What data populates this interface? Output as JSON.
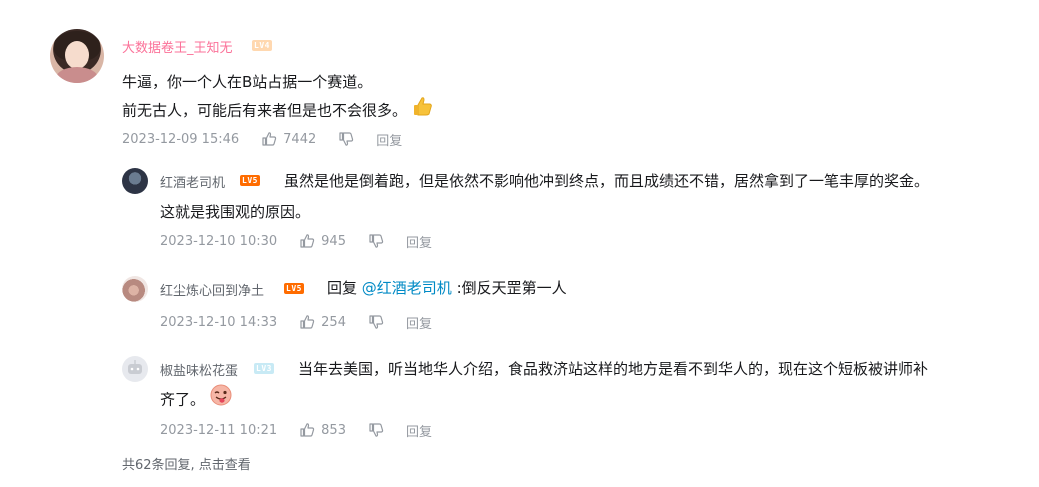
{
  "main_comment": {
    "username": "大数据卷王_王知无",
    "level": "LV4",
    "line1": "牛逼，你一个人在B站占据一个赛道。",
    "line2": "前无古人，可能后有来者但是也不会很多。",
    "line2_emoji": "thumbs-up",
    "time": "2023-12-09 15:46",
    "likes": "7442",
    "reply_label": "回复"
  },
  "replies": [
    {
      "username": "红酒老司机",
      "level": "LV5",
      "line1": "虽然是他是倒着跑，但是依然不影响他冲到终点，而且成绩还不错，居然拿到了一笔丰厚的奖金。",
      "line2": "这就是我围观的原因。",
      "time": "2023-12-10 10:30",
      "likes": "945",
      "reply_label": "回复"
    },
    {
      "username": "红尘炼心回到净土",
      "level": "LV5",
      "reply_prefix": "回复",
      "mention": "@红酒老司机",
      "text": ":倒反天罡第一人",
      "time": "2023-12-10 14:33",
      "likes": "254",
      "reply_label": "回复"
    },
    {
      "username": "椒盐味松花蛋",
      "level": "LV3",
      "line1": "当年去美国，听当地华人介绍，食品救济站这样的地方是看不到华人的，现在这个短板被讲师补",
      "line2": "齐了。",
      "line2_emoji": "tongue-wink",
      "time": "2023-12-11 10:21",
      "likes": "853",
      "reply_label": "回复"
    }
  ],
  "footer": {
    "text": "共62条回复, 点击查看"
  },
  "colors": {
    "username_vip": "#fb7299",
    "meta_gray": "#9499a0",
    "mention_blue": "#008ac5"
  }
}
